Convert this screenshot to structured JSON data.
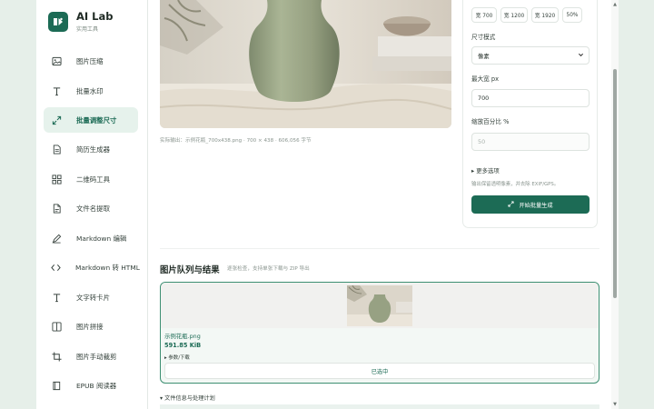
{
  "app": {
    "title": "AI Lab",
    "subtitle": "实用工具"
  },
  "sidebar": {
    "items": [
      {
        "label": "图片压缩",
        "icon": "image-icon"
      },
      {
        "label": "批量水印",
        "icon": "text-icon"
      },
      {
        "label": "批量调整尺寸",
        "icon": "expand-icon",
        "active": true
      },
      {
        "label": "简历生成器",
        "icon": "document-icon"
      },
      {
        "label": "二维码工具",
        "icon": "grid-icon"
      },
      {
        "label": "文件名提取",
        "icon": "file-icon"
      },
      {
        "label": "Markdown 编辑",
        "icon": "edit-icon"
      },
      {
        "label": "Markdown 转 HTML",
        "icon": "code-icon"
      },
      {
        "label": "文字转卡片",
        "icon": "text-icon"
      },
      {
        "label": "图片拼接",
        "icon": "layout-icon"
      },
      {
        "label": "图片手动裁剪",
        "icon": "crop-icon"
      },
      {
        "label": "EPUB 阅读器",
        "icon": "book-icon"
      }
    ]
  },
  "preview": {
    "actual_output": "实际输出：示例花瓶_700x438.png · 700 × 438 · 606,056 字节"
  },
  "settings": {
    "presets": [
      "宽 700",
      "宽 1200",
      "宽 1920",
      "50%"
    ],
    "size_mode_label": "尺寸模式",
    "size_mode_value": "像素",
    "max_width_label": "最大宽 px",
    "max_width_value": "700",
    "scale_label": "缩放百分比 %",
    "scale_placeholder": "50",
    "more_options": "▸ 更多选项",
    "hint": "输出保留透明像素，并去除 EXIF/GPS。",
    "generate_button": "开始批量生成"
  },
  "queue": {
    "title": "图片队列与结果",
    "subtitle": "逐张检查，支持单张下载与 ZIP 导出",
    "file_name": "示例花瓶.png",
    "file_size": "591.85 KiB",
    "link": "▸ 参数/下载",
    "selected": "已选中",
    "file_info": "▾ 文件信息与处理计划"
  },
  "colors": {
    "accent": "#1c6b55",
    "active_bg": "#e6f2ec",
    "card_border": "#3d8f72"
  }
}
